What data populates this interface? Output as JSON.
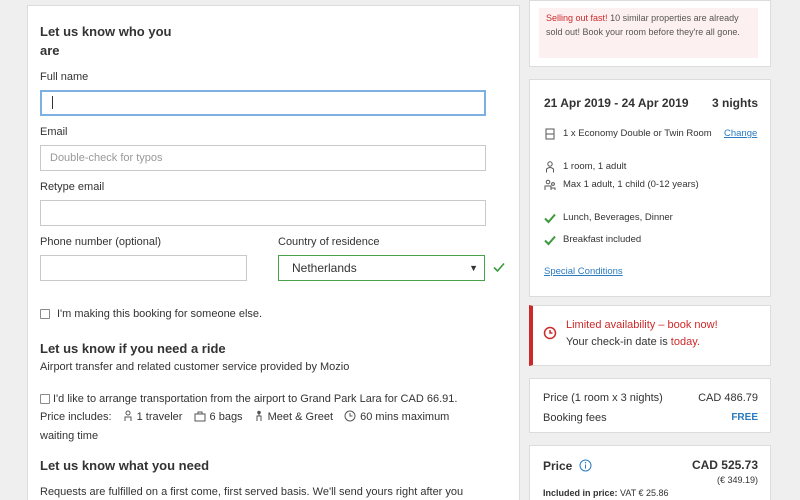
{
  "form": {
    "heading_who": "Let us know who you are",
    "full_name_label": "Full name",
    "full_name_value": "",
    "email_label": "Email",
    "email_placeholder": "Double-check for typos",
    "retype_label": "Retype email",
    "phone_label": "Phone number (optional)",
    "country_label": "Country of residence",
    "country_value": "Netherlands",
    "someone_else_label": "I'm making this booking for someone else.",
    "ride_heading": "Let us know if you need a ride",
    "ride_sub": "Airport transfer and related customer service provided by Mozio",
    "ride_checkbox_label": "I'd like to arrange transportation from the airport to Grand Park Lara for CAD 66.91.",
    "price_includes_label": "Price includes:",
    "includes": [
      "1 traveler",
      "6 bags",
      "Meet & Greet",
      "60 mins maximum"
    ],
    "waiting_time": "waiting time",
    "need_heading": "Let us know what you need",
    "need_text": "Requests are fulfilled on a first come, first served basis. We'll send yours right after you"
  },
  "sidebar": {
    "selling_title": "Selling out fast!",
    "selling_text": "10 similar properties are already sold out! Book your room before they're all gone.",
    "stay_dates": "21 Apr 2019 - 24 Apr 2019",
    "stay_nights": "3 nights",
    "room_type": "1 x Economy Double or Twin Room",
    "change_link": "Change",
    "rooms": "1 room, 1 adult",
    "max_occupancy": "Max 1 adult, 1 child (0-12 years)",
    "meals": "Lunch, Beverages, Dinner",
    "breakfast": "Breakfast included",
    "special_conditions": "Special Conditions",
    "limited_title": "Limited availability – book now!",
    "limited_text_pre": "Your check-in date is",
    "limited_text_em": "today.",
    "price_label": "Price (1 room x 3 nights)",
    "price_value": "CAD 486.79",
    "fees_label": "Booking fees",
    "fees_value": "FREE",
    "total_label": "Price",
    "total_value": "CAD 525.73",
    "total_sub": "(€ 349.19)",
    "included_label": "Included in price:",
    "included_value": "VAT € 25.86"
  },
  "colors": {
    "accent_blue": "#2a7bc0",
    "red": "#cc2a2a",
    "green": "#3c9a3c"
  }
}
